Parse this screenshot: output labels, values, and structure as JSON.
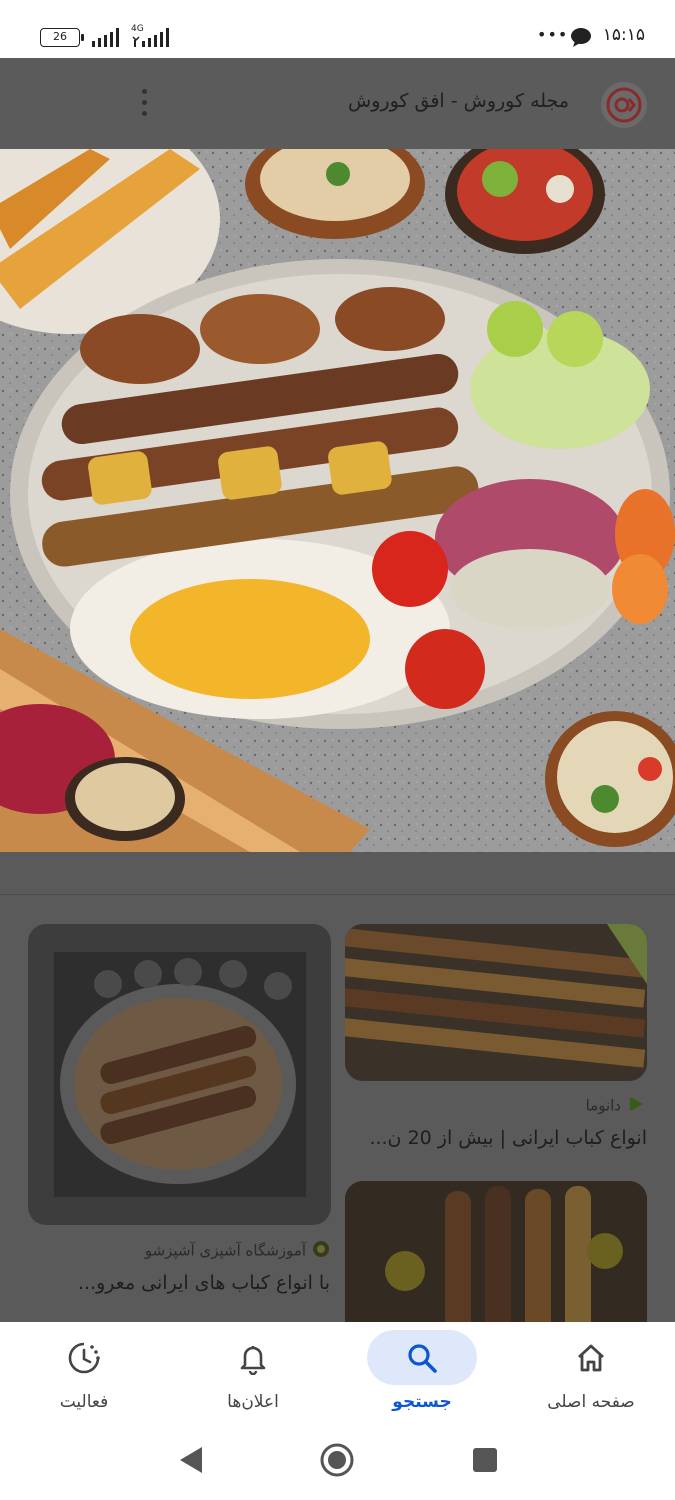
{
  "status_bar": {
    "battery": "26",
    "network": "4G",
    "time": "۱۵:۱۵"
  },
  "app_bar": {
    "title": "مجله کوروش - افق کوروش"
  },
  "results": [
    {
      "source": "دانوما",
      "title": "انواع کباب ایرانی | بیش از 20 ن..."
    },
    {
      "source": "آموزشگاه آشپزی آشپزشو",
      "title": "با انواع کباب های ایرانی معرو..."
    }
  ],
  "bottom_nav": {
    "home": "صفحه اصلی",
    "search": "جستجو",
    "notifications": "اعلان‌ها",
    "activity": "فعالیت",
    "active_tab": "search"
  },
  "colors": {
    "accent": "#0b57d0",
    "active_pill": "#dfe8fb",
    "scrim": "#5a5a5a"
  }
}
